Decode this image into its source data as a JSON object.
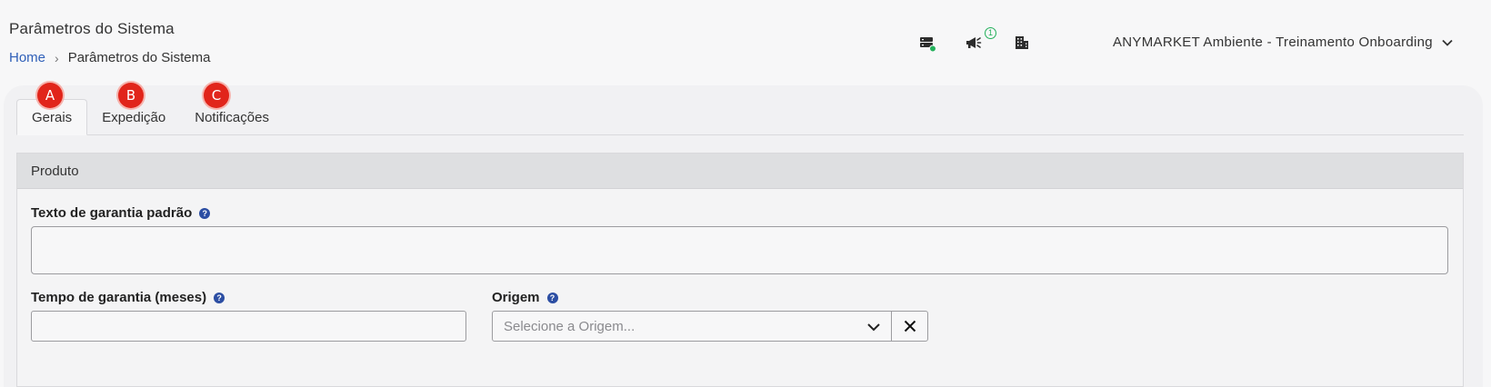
{
  "header": {
    "title": "Parâmetros do Sistema",
    "breadcrumb": {
      "home": "Home",
      "separator": "›",
      "current": "Parâmetros do Sistema"
    },
    "icons": {
      "server_status": "server-status-icon",
      "announcements": "megaphone-icon",
      "announcements_count": "1",
      "company": "building-icon"
    },
    "account_label": "ANYMARKET Ambiente - Treinamento Onboarding"
  },
  "tabs": [
    {
      "label": "Gerais",
      "badge": "A",
      "active": true
    },
    {
      "label": "Expedição",
      "badge": "B",
      "active": false
    },
    {
      "label": "Notificações",
      "badge": "C",
      "active": false
    }
  ],
  "panel": {
    "title": "Produto",
    "fields": {
      "warranty_text": {
        "label": "Texto de garantia padrão",
        "value": ""
      },
      "warranty_time": {
        "label": "Tempo de garantia (meses)",
        "value": ""
      },
      "origin": {
        "label": "Origem",
        "placeholder": "Selecione a Origem...",
        "clear": "×"
      }
    },
    "help_glyph": "?"
  },
  "colors": {
    "link": "#2f5fb8",
    "badge": "#e1251b",
    "help": "#2c4ea3",
    "status_ok": "#23b05b"
  }
}
